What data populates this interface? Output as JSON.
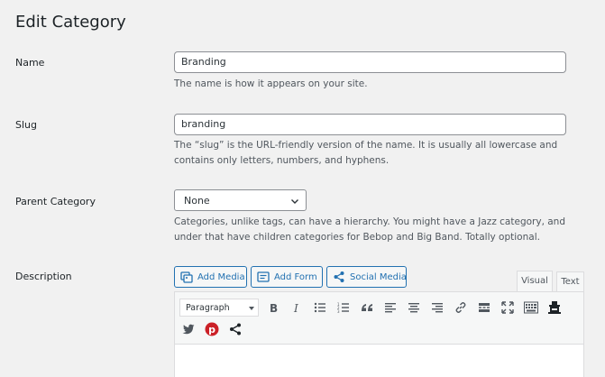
{
  "page": {
    "title": "Edit Category"
  },
  "fields": {
    "name": {
      "label": "Name",
      "value": "Branding",
      "help": "The name is how it appears on your site."
    },
    "slug": {
      "label": "Slug",
      "value": "branding",
      "help_line1": "The “slug” is the URL-friendly version of the name. It is usually all lowercase and",
      "help_line2": "contains only letters, numbers, and hyphens."
    },
    "parent": {
      "label": "Parent Category",
      "value": "None",
      "help_line1": "Categories, unlike tags, can have a hierarchy. You might have a Jazz category, and",
      "help_line2": "under that have children categories for Bebop and Big Band. Totally optional."
    },
    "description": {
      "label": "Description"
    }
  },
  "editor": {
    "buttons": {
      "add_media": "Add Media",
      "add_form": "Add Form",
      "social_media": "Social Media"
    },
    "tabs": {
      "visual": "Visual",
      "text": "Text"
    },
    "format_select": "Paragraph",
    "toolbar_icons": [
      "bold-icon",
      "italic-icon",
      "bulleted-list-icon",
      "numbered-list-icon",
      "blockquote-icon",
      "align-left-icon",
      "align-center-icon",
      "align-right-icon",
      "link-icon",
      "read-more-icon",
      "fullscreen-icon",
      "toolbar-toggle-icon",
      "form-icon",
      "twitter-icon",
      "pinterest-icon",
      "share-icon"
    ]
  },
  "colors": {
    "accent": "#2271b1",
    "pinterest": "#cb2027"
  }
}
